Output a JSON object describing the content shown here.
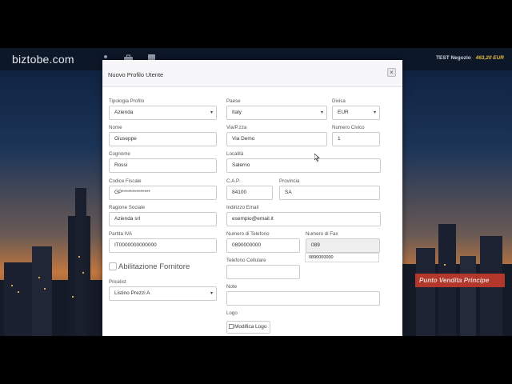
{
  "app": {
    "brand": "biztobe.com",
    "store_name": "TEST Negozio",
    "credit": "463,20 EUR",
    "store_badge": "Punto Vendita Principe"
  },
  "nav_icons": [
    "users-icon",
    "briefcase-icon",
    "document-icon"
  ],
  "modal": {
    "title": "Nuovo Profilo Utente",
    "close_glyph": "×"
  },
  "form": {
    "tipologia": {
      "label": "Tipologia Profilo",
      "value": "Azienda"
    },
    "paese": {
      "label": "Paese",
      "value": "Italy"
    },
    "divisa": {
      "label": "Divisa",
      "value": "EUR"
    },
    "nome": {
      "label": "Nome",
      "value": "Giuseppe"
    },
    "via": {
      "label": "Via/P.zza",
      "value": "Via Demo"
    },
    "civico": {
      "label": "Numero Civico",
      "value": "1"
    },
    "cognome": {
      "label": "Cognome",
      "value": "Rossi"
    },
    "localita": {
      "label": "Località",
      "value": "Salerno"
    },
    "codice_fiscale": {
      "label": "Codice Fiscale",
      "value": "GP**************"
    },
    "cap": {
      "label": "C.A.P.",
      "value": "84100"
    },
    "provincia": {
      "label": "Provincia",
      "value": "SA"
    },
    "ragione_sociale": {
      "label": "Ragione Sociale",
      "value": "Azienda srl"
    },
    "email": {
      "label": "Indirizzo Email",
      "value": "esempio@email.it"
    },
    "partita_iva": {
      "label": "Partita IVA",
      "value": "IT0000000000000"
    },
    "telefono": {
      "label": "Numero di Telefono",
      "value": "0890000000"
    },
    "fax": {
      "label": "Numero di Fax",
      "value": "089",
      "suggestion": "0890000000"
    },
    "fornitore": {
      "label": "Abilitazione Fornitore"
    },
    "cellulare": {
      "label": "Telefono Cellulare",
      "value": ""
    },
    "pricelist": {
      "label": "Pricelist",
      "value": "Listino Prezzi A"
    },
    "note": {
      "label": "Note",
      "value": ""
    },
    "logo": {
      "label": "Logo",
      "button": "Modifica Logo"
    }
  },
  "colors": {
    "topbar": "#0c1728",
    "credit": "#e4b93a",
    "badge": "#c0392b"
  }
}
